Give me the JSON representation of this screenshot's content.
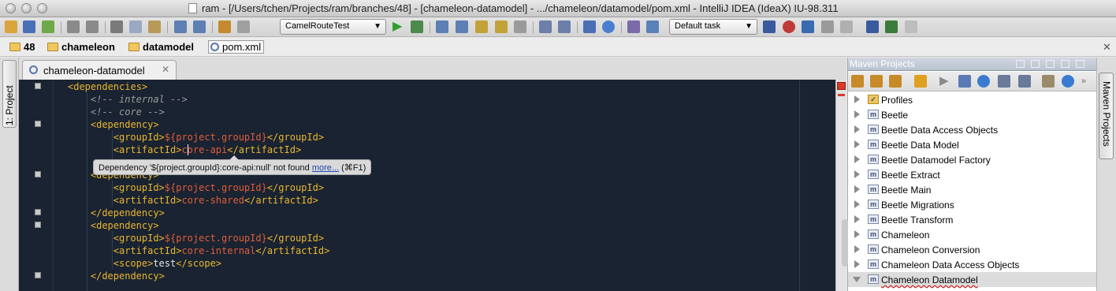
{
  "window": {
    "title": "ram - [/Users/tchen/Projects/ram/branches/48] - [chameleon-datamodel] - .../chameleon/datamodel/pom.xml - IntelliJ IDEA (IdeaX) IU-98.311"
  },
  "toolbar": {
    "run_config": "CamelRouteTest",
    "task": "Default task",
    "icons": [
      "open-icon",
      "save-icon",
      "sync-icon",
      "undo-icon",
      "redo-icon",
      "cut-icon",
      "copy-icon",
      "paste-icon",
      "find-icon",
      "replace-icon",
      "back-icon",
      "forward-icon",
      "run-icon",
      "debug-icon",
      "build-icon",
      "settings-icon",
      "help-icon",
      "task-icon",
      "vcs-icon"
    ]
  },
  "breadcrumbs": [
    "48",
    "chameleon",
    "datamodel",
    "pom.xml"
  ],
  "left_panel": {
    "tab_label": "1: Project"
  },
  "editor": {
    "tab_label": "chameleon-datamodel",
    "lines": [
      {
        "indent": 2,
        "parts": [
          [
            "tg",
            "<dependencies>"
          ]
        ]
      },
      {
        "indent": 3,
        "parts": [
          [
            "cm",
            "<!-- internal -->"
          ]
        ]
      },
      {
        "indent": 3,
        "parts": [
          [
            "cm",
            "<!-- core -->"
          ]
        ]
      },
      {
        "indent": 3,
        "parts": [
          [
            "tg",
            "<dependency>"
          ]
        ]
      },
      {
        "indent": 4,
        "parts": [
          [
            "tg",
            "<groupId>"
          ],
          [
            "vr",
            "${project.groupId}"
          ],
          [
            "tg",
            "</groupId>"
          ]
        ]
      },
      {
        "indent": 4,
        "parts": [
          [
            "tg",
            "<artifactId>"
          ],
          [
            "vr",
            "core-api"
          ],
          [
            "tg",
            "</artifactId>"
          ]
        ]
      },
      {
        "indent": 4,
        "parts": []
      },
      {
        "indent": 3,
        "parts": [
          [
            "tg",
            "<dependency>"
          ]
        ]
      },
      {
        "indent": 4,
        "parts": [
          [
            "tg",
            "<groupId>"
          ],
          [
            "vr",
            "${project.groupId}"
          ],
          [
            "tg",
            "</groupId>"
          ]
        ]
      },
      {
        "indent": 4,
        "parts": [
          [
            "tg",
            "<artifactId>"
          ],
          [
            "vr",
            "core-shared"
          ],
          [
            "tg",
            "</artifactId>"
          ]
        ]
      },
      {
        "indent": 3,
        "parts": [
          [
            "tg",
            "</dependency>"
          ]
        ]
      },
      {
        "indent": 3,
        "parts": [
          [
            "tg",
            "<dependency>"
          ]
        ]
      },
      {
        "indent": 4,
        "parts": [
          [
            "tg",
            "<groupId>"
          ],
          [
            "vr",
            "${project.groupId}"
          ],
          [
            "tg",
            "</groupId>"
          ]
        ]
      },
      {
        "indent": 4,
        "parts": [
          [
            "tg",
            "<artifactId>"
          ],
          [
            "vr",
            "core-internal"
          ],
          [
            "tg",
            "</artifactId>"
          ]
        ]
      },
      {
        "indent": 4,
        "parts": [
          [
            "tg",
            "<scope>"
          ],
          [
            "tx",
            "test"
          ],
          [
            "tg",
            "</scope>"
          ]
        ]
      },
      {
        "indent": 3,
        "parts": [
          [
            "tg",
            "</dependency>"
          ]
        ]
      }
    ],
    "tooltip": {
      "message": "Dependency '${project.groupId}:core-api:null' not found ",
      "link": "more...",
      "shortcut": " (⌘F1)"
    }
  },
  "maven": {
    "title": "Maven Projects",
    "side_tab_label": "Maven Projects",
    "items": [
      {
        "label": "Profiles",
        "type": "profiles",
        "expanded": false,
        "selected": false
      },
      {
        "label": "Beetle",
        "type": "module",
        "expanded": false,
        "selected": false
      },
      {
        "label": "Beetle Data Access Objects",
        "type": "module",
        "expanded": false,
        "selected": false
      },
      {
        "label": "Beetle Data Model",
        "type": "module",
        "expanded": false,
        "selected": false
      },
      {
        "label": "Beetle Datamodel Factory",
        "type": "module",
        "expanded": false,
        "selected": false
      },
      {
        "label": "Beetle Extract",
        "type": "module",
        "expanded": false,
        "selected": false
      },
      {
        "label": "Beetle Main",
        "type": "module",
        "expanded": false,
        "selected": false
      },
      {
        "label": "Beetle Migrations",
        "type": "module",
        "expanded": false,
        "selected": false
      },
      {
        "label": "Beetle Transform",
        "type": "module",
        "expanded": false,
        "selected": false
      },
      {
        "label": "Chameleon",
        "type": "module",
        "expanded": false,
        "selected": false
      },
      {
        "label": "Chameleon Conversion",
        "type": "module",
        "expanded": false,
        "selected": false
      },
      {
        "label": "Chameleon Data Access Objects",
        "type": "module",
        "expanded": false,
        "selected": false
      },
      {
        "label": "Chameleon Datamodel",
        "type": "module",
        "expanded": true,
        "selected": true
      }
    ]
  },
  "colors": {
    "editor_bg": "#1a2331",
    "tag": "#e9b730",
    "value": "#e05d3b",
    "comment": "#9a9a9a",
    "error": "#d83b2a"
  }
}
